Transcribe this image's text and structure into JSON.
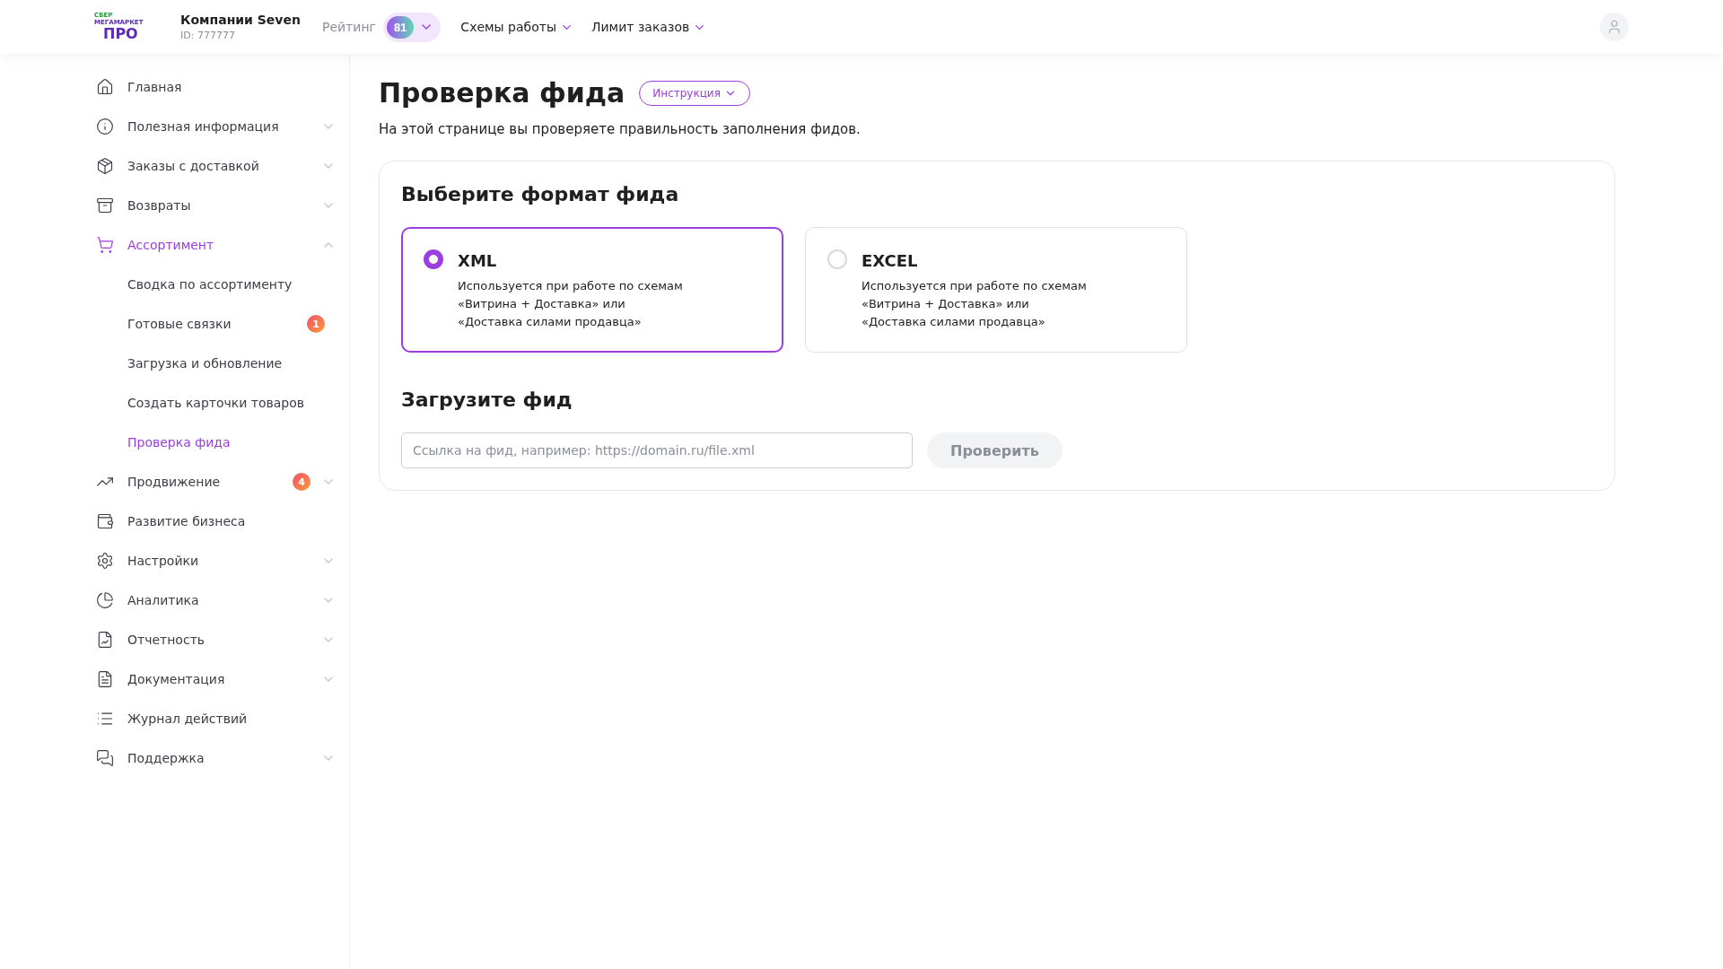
{
  "header": {
    "logo": {
      "top": "СБЕР",
      "middle": "МЕГАМАРКЕТ",
      "bottom": "ПРО"
    },
    "company": "Компании Seven",
    "company_id": "ID: 777777",
    "rating_label": "Рейтинг",
    "rating_value": "81",
    "menus": [
      "Схемы работы",
      "Лимит заказов"
    ]
  },
  "sidebar": {
    "items": [
      {
        "label": "Главная",
        "selected": false
      },
      {
        "label": "Полезная информация",
        "selected": false,
        "expanded": false
      },
      {
        "label": "Заказы с доставкой",
        "selected": false,
        "expanded": false
      },
      {
        "label": "Возвраты",
        "selected": false,
        "expanded": false
      },
      {
        "label": "Ассортимент",
        "selected": true,
        "expanded": true,
        "children": [
          {
            "label": "Сводка по ассортименту",
            "selected": false
          },
          {
            "label": "Готовые связки",
            "selected": false,
            "badge": "1"
          },
          {
            "label": "Загрузка и обновление",
            "selected": false
          },
          {
            "label": "Создать карточки товаров",
            "selected": false
          },
          {
            "label": "Проверка фида",
            "selected": true
          }
        ]
      },
      {
        "label": "Продвижение",
        "selected": false,
        "expanded": false,
        "badge": "4"
      },
      {
        "label": "Развитие бизнеса",
        "selected": false
      },
      {
        "label": "Настройки",
        "selected": false,
        "expanded": false
      },
      {
        "label": "Аналитика",
        "selected": false,
        "expanded": false
      },
      {
        "label": "Отчетность",
        "selected": false,
        "expanded": false
      },
      {
        "label": "Документация",
        "selected": false,
        "expanded": false
      },
      {
        "label": "Журнал действий",
        "selected": false
      },
      {
        "label": "Поддержка",
        "selected": false,
        "expanded": false
      }
    ]
  },
  "page": {
    "title": "Проверка фида",
    "instructions_button": "Инструкция",
    "description": "На этой странице вы проверяете правильность заполнения фидов.",
    "format_heading": "Выберите формат фида",
    "formats": [
      {
        "name": "XML",
        "description": "Используется при работе по схемам\n«Витрина + Доставка» или\n«Доставка силами продавца»",
        "selected": true
      },
      {
        "name": "EXCEL",
        "description": "Используется при работе по схемам\n«Витрина + Доставка» или\n«Доставка силами продавца»",
        "selected": false
      }
    ],
    "upload_heading": "Загрузите фид",
    "url_field": {
      "placeholder": "Ссылка на фид, например: https://domain.ru/file.xml"
    },
    "check_button": "Проверить"
  }
}
